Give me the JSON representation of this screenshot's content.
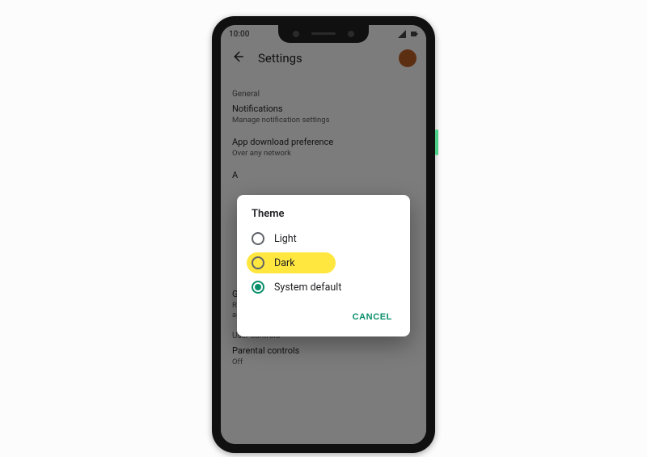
{
  "statusbar": {
    "time": "10:00"
  },
  "appbar": {
    "title": "Settings"
  },
  "sections": {
    "general": {
      "label": "General",
      "notifications": {
        "title": "Notifications",
        "sub": "Manage notification settings"
      },
      "download_pref": {
        "title": "App download preference",
        "sub": "Over any network"
      },
      "auto_update": {
        "title": "A"
      },
      "play_prefs": {
        "title": "Google Play preferences",
        "sub": "Remove history in your Wishlist, the Beta program, and other lists"
      }
    },
    "user_controls": {
      "label": "User controls",
      "parental": {
        "title": "Parental controls",
        "sub": "Off"
      }
    }
  },
  "dialog": {
    "title": "Theme",
    "options": {
      "light": {
        "label": "Light",
        "selected": false,
        "highlight": false
      },
      "dark": {
        "label": "Dark",
        "selected": false,
        "highlight": true
      },
      "system": {
        "label": "System default",
        "selected": true,
        "highlight": false
      }
    },
    "cancel": "CANCEL"
  }
}
